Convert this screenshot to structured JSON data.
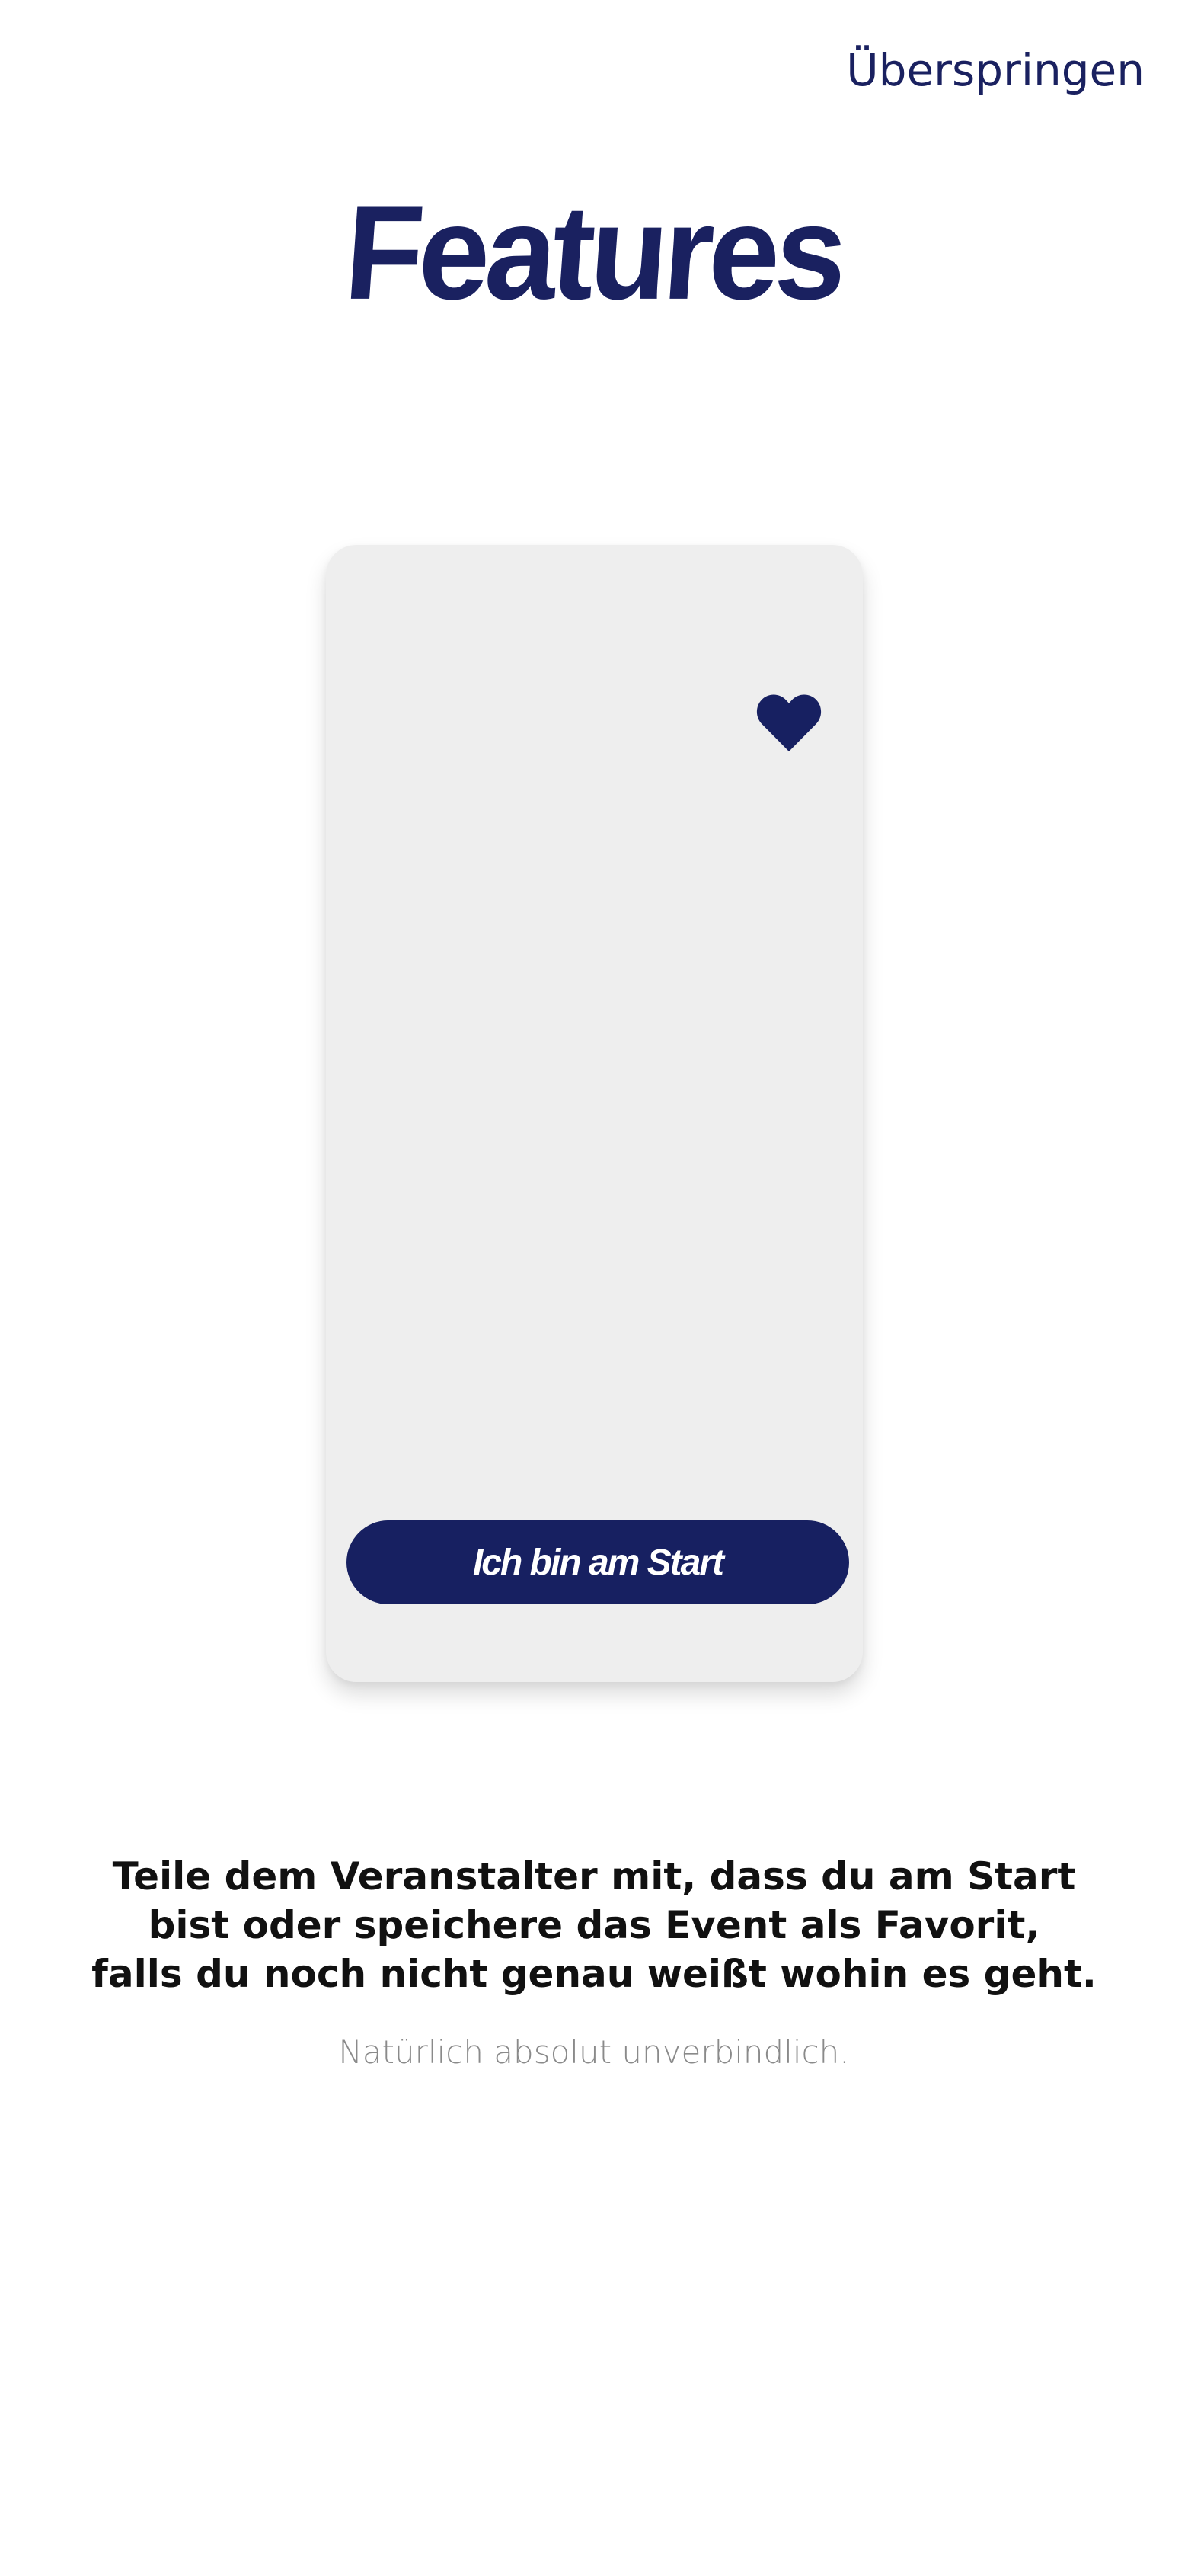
{
  "header": {
    "skip_label": "Überspringen",
    "title": "Features"
  },
  "card": {
    "favorite_icon": "heart-icon",
    "start_button_label": "Ich bin am Start"
  },
  "description": {
    "lines": [
      "Teile dem Veranstalter mit, dass du am Start",
      "bist oder speichere das Event als Favorit,",
      "falls du noch nicht genau weißt wohin es geht."
    ],
    "note": "Natürlich absolut unverbindlich."
  },
  "colors": {
    "brand_navy": "#172061",
    "card_background": "#eeeeee",
    "page_background": "#ffffff",
    "note_gray": "#8a8a8a"
  }
}
